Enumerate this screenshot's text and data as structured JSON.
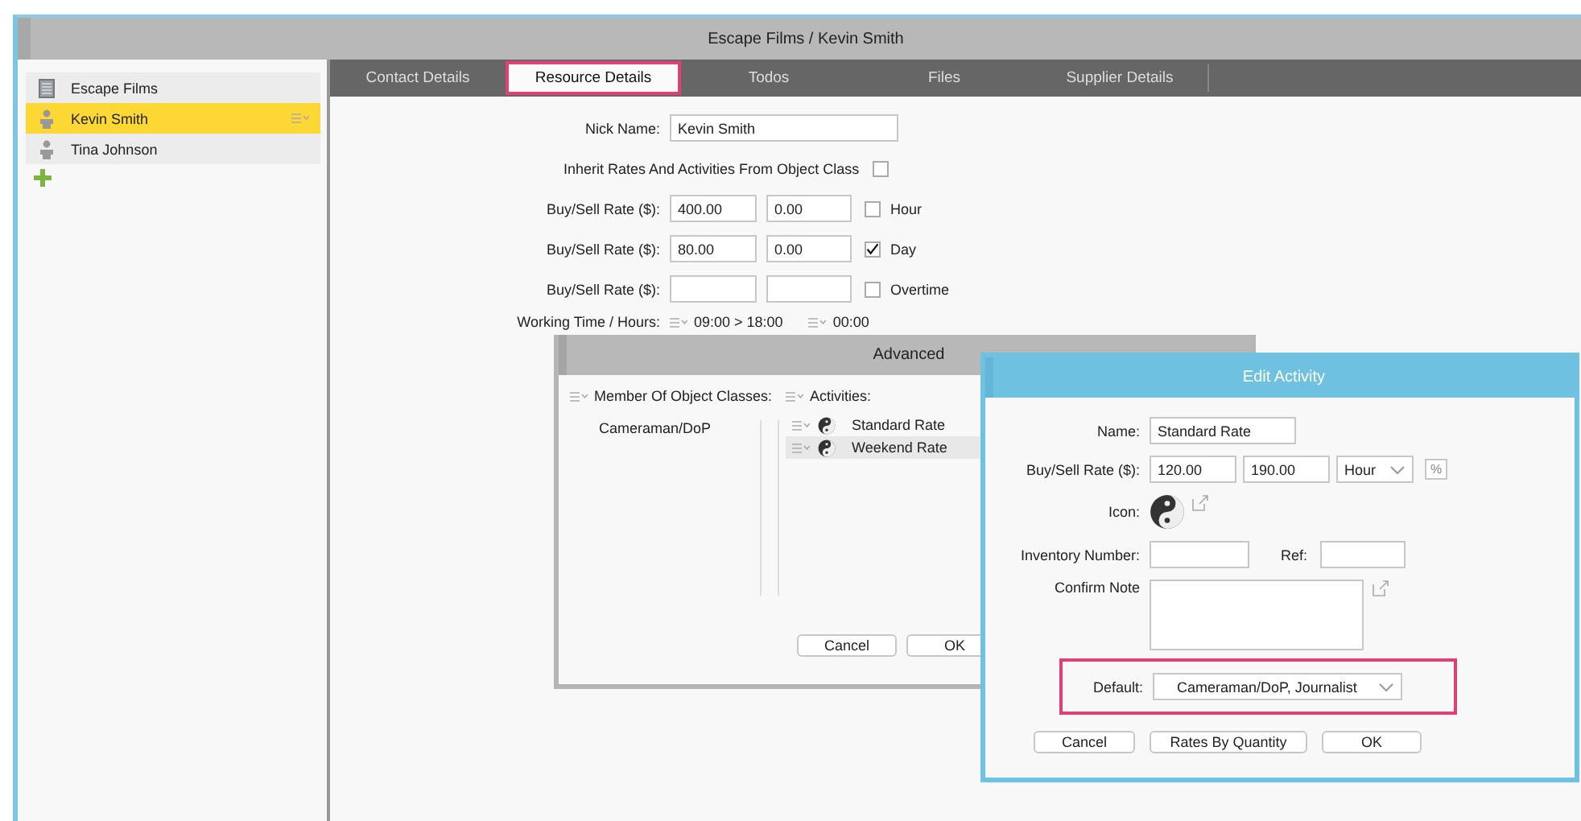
{
  "window": {
    "title": "Escape Films / Kevin Smith"
  },
  "sidebar": {
    "items": [
      {
        "kind": "company",
        "label": "Escape Films",
        "selected": false
      },
      {
        "kind": "person",
        "label": "Kevin Smith",
        "selected": true
      },
      {
        "kind": "person",
        "label": "Tina Johnson",
        "selected": false
      }
    ]
  },
  "tabs": [
    {
      "label": "Contact Details",
      "selected": false,
      "highlighted": false
    },
    {
      "label": "Resource Details",
      "selected": true,
      "highlighted": true
    },
    {
      "label": "Todos",
      "selected": false,
      "highlighted": false
    },
    {
      "label": "Files",
      "selected": false,
      "highlighted": false
    },
    {
      "label": "Supplier Details",
      "selected": false,
      "highlighted": false
    }
  ],
  "form": {
    "nick_name": {
      "label": "Nick Name:",
      "value": "Kevin Smith"
    },
    "inherit": {
      "label": "Inherit Rates And Activities From Object Class",
      "checked": false
    },
    "rates": [
      {
        "label": "Buy/Sell Rate ($):",
        "buy": "400.00",
        "sell": "0.00",
        "unit": "Hour",
        "checked": false
      },
      {
        "label": "Buy/Sell Rate ($):",
        "buy": "80.00",
        "sell": "0.00",
        "unit": "Day",
        "checked": true
      },
      {
        "label": "Buy/Sell Rate ($):",
        "unit": "Overtime",
        "checked": false
      }
    ],
    "working_time": {
      "label": "Working Time / Hours:",
      "hours": "09:00 > 18:00",
      "overtime": "00:00"
    }
  },
  "advanced_dialog": {
    "title": "Advanced",
    "classes_header": "Member Of Object Classes:",
    "classes": [
      "Cameraman/DoP"
    ],
    "activities_header": "Activities:",
    "activities": [
      {
        "label": "Standard Rate",
        "selected": false
      },
      {
        "label": "Weekend Rate",
        "selected": true
      }
    ],
    "buttons": [
      "Cancel",
      "OK"
    ]
  },
  "edit_dialog": {
    "title": "Edit Activity",
    "name": {
      "label": "Name:",
      "value": "Standard Rate"
    },
    "rate": {
      "label": "Buy/Sell Rate ($):",
      "buy": "120.00",
      "sell": "190.00",
      "unit": "Hour",
      "percent": "%"
    },
    "icon_label": "Icon:",
    "inventory": {
      "label": "Inventory Number:"
    },
    "ref": {
      "label": "Ref:"
    },
    "confirm_note": {
      "label": "Confirm Note"
    },
    "default": {
      "label": "Default:",
      "value": "Cameraman/DoP, Journalist",
      "highlighted": true
    },
    "buttons": [
      "Cancel",
      "Rates By Quantity",
      "OK"
    ]
  }
}
